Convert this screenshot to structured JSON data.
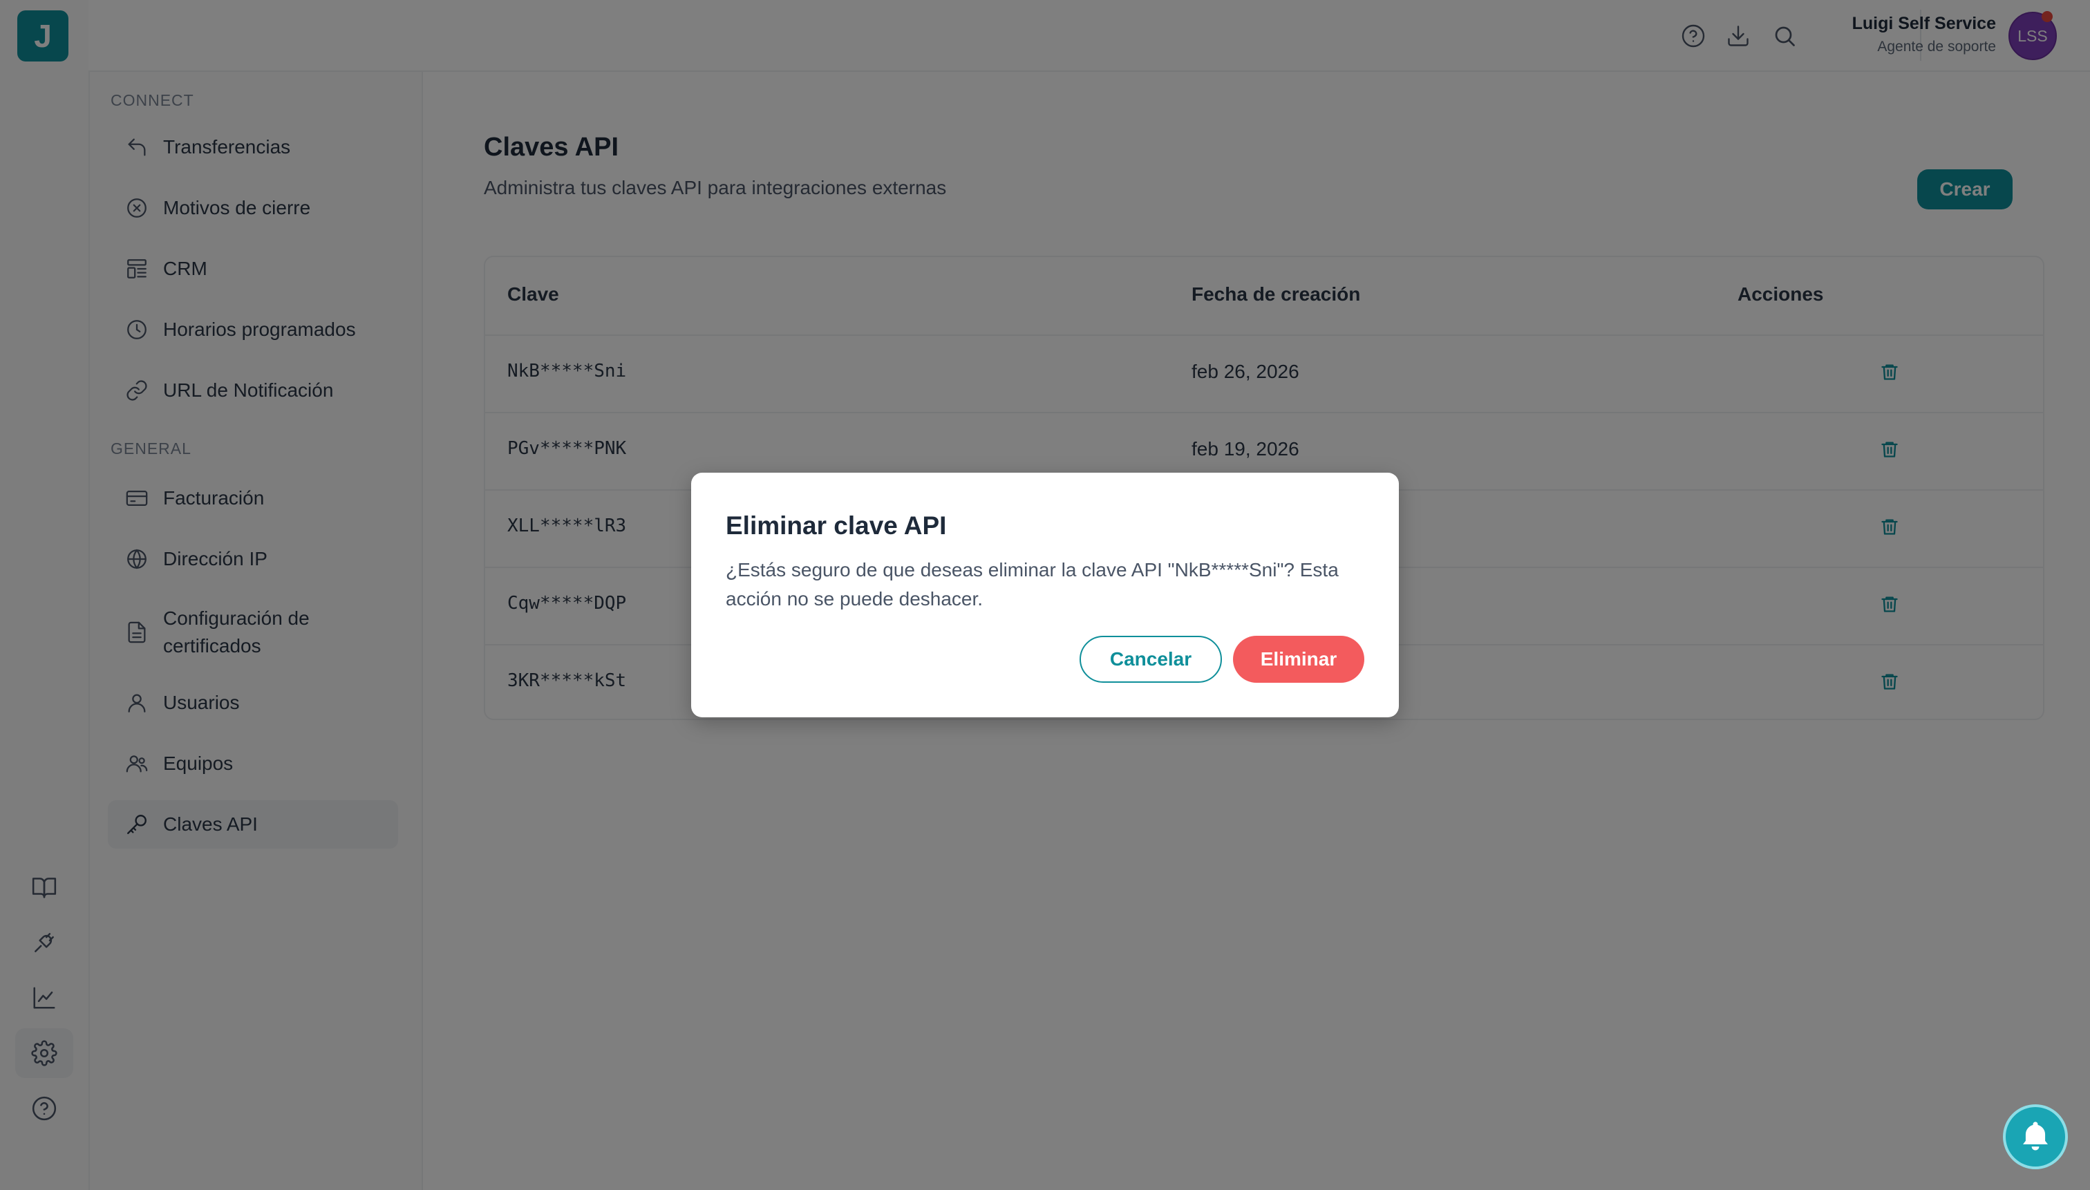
{
  "brand": {
    "logo_letter": "J",
    "accent": "#0f8f9a",
    "danger": "#f35b5d"
  },
  "rail": {
    "items": [
      {
        "name": "book-icon"
      },
      {
        "name": "plug-icon"
      },
      {
        "name": "chart-icon"
      },
      {
        "name": "gear-icon",
        "active": true
      },
      {
        "name": "help-icon"
      }
    ]
  },
  "topbar": {
    "icons": [
      "help-circle-icon",
      "download-icon",
      "search-icon"
    ],
    "user": {
      "name": "Luigi Self Service",
      "role": "Agente de soporte",
      "initials": "LSS"
    }
  },
  "sidebar": {
    "sections": [
      {
        "label": "CONNECT",
        "items": [
          {
            "label": "Transferencias",
            "icon": "reply-arrow-icon"
          },
          {
            "label": "Motivos de cierre",
            "icon": "x-circle-icon"
          },
          {
            "label": "CRM",
            "icon": "layout-icon"
          },
          {
            "label": "Horarios programados",
            "icon": "clock-icon"
          },
          {
            "label": "URL de Notificación",
            "icon": "link-icon"
          }
        ]
      },
      {
        "label": "GENERAL",
        "items": [
          {
            "label": "Facturación",
            "icon": "credit-card-icon"
          },
          {
            "label": "Dirección IP",
            "icon": "globe-icon"
          },
          {
            "label": "Configuración de certificados",
            "icon": "file-icon"
          },
          {
            "label": "Usuarios",
            "icon": "user-icon"
          },
          {
            "label": "Equipos",
            "icon": "users-icon"
          },
          {
            "label": "Claves API",
            "icon": "key-icon",
            "active": true
          }
        ]
      }
    ]
  },
  "main": {
    "title": "Claves API",
    "subtitle": "Administra tus claves API para integraciones externas",
    "create_label": "Crear",
    "table": {
      "columns": [
        "Clave",
        "Fecha de creación",
        "Acciones"
      ],
      "rows": [
        {
          "key": "NkB*****Sni",
          "date": "feb 26, 2026"
        },
        {
          "key": "PGv*****PNK",
          "date": "feb 19, 2026"
        },
        {
          "key": "XLL*****lR3",
          "date": ""
        },
        {
          "key": "Cqw*****DQP",
          "date": ""
        },
        {
          "key": "3KR*****kSt",
          "date": ""
        }
      ]
    }
  },
  "modal": {
    "title": "Eliminar clave API",
    "body": "¿Estás seguro de que deseas eliminar la clave API \"NkB*****Sni\"? Esta acción no se puede deshacer.",
    "cancel_label": "Cancelar",
    "delete_label": "Eliminar"
  }
}
